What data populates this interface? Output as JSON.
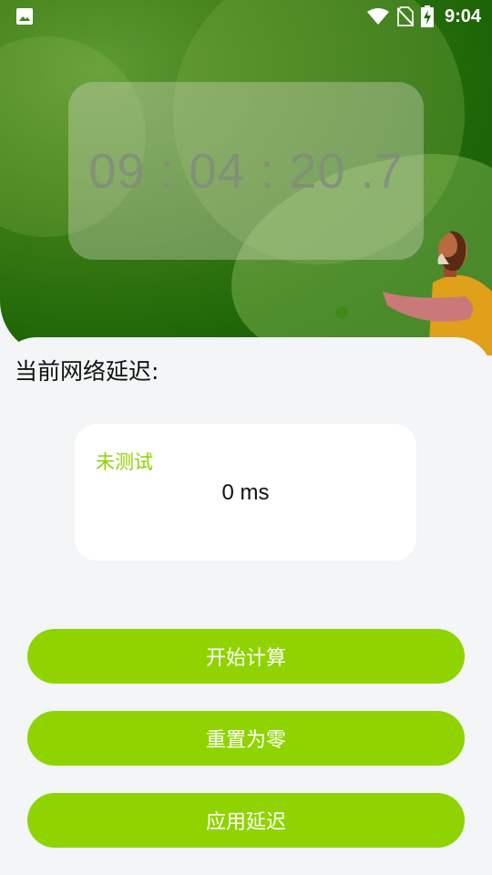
{
  "status_bar": {
    "time": "9:04",
    "icons": [
      "image-icon",
      "wifi-icon",
      "no-sim-icon",
      "battery-charging-icon"
    ]
  },
  "clock": {
    "display": "09 : 04 : 20 .7"
  },
  "latency": {
    "title": "当前网络延迟:",
    "status": "未测试",
    "value": "0 ms"
  },
  "actions": {
    "start": "开始计算",
    "reset": "重置为零",
    "apply": "应用延迟"
  },
  "colors": {
    "accent": "#8fd400",
    "status_text": "#8fd100",
    "hero_green": "#1d6507",
    "background": "#f3f5f6"
  }
}
